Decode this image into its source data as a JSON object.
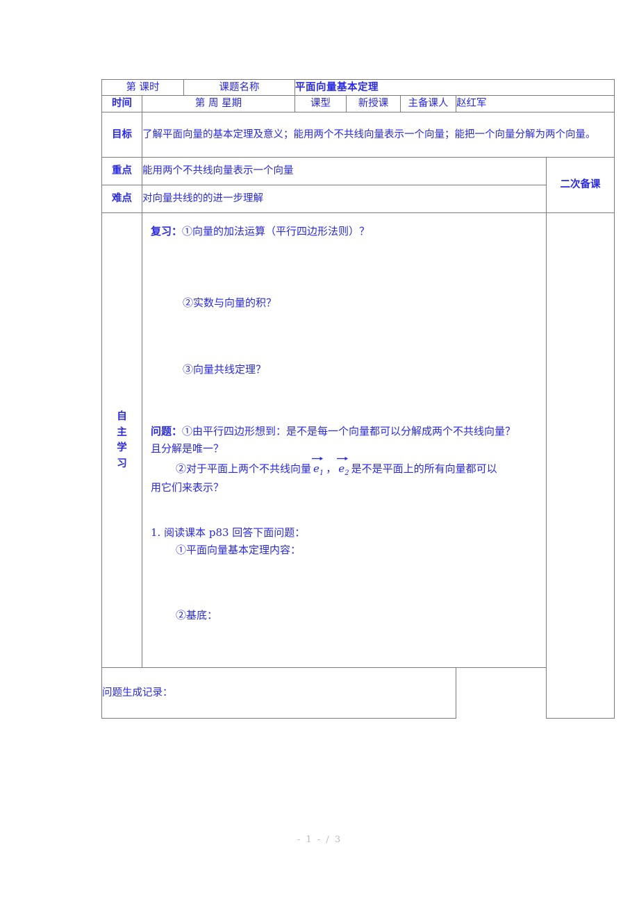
{
  "document": {
    "title": "平面向量基本定理",
    "text_color": "#2929e4",
    "title_color": "#111111",
    "border_color": "#7a7a7a"
  },
  "header": {
    "period_label": "第      课时",
    "topic_label": "课题名称",
    "topic_value": "平面向量基本定理",
    "time_label": "时间",
    "week_day_label": "第    周    星期",
    "class_type_label": "课型",
    "class_type_value": "新授课",
    "preparer_label": "主备课人",
    "preparer_value": "赵红军"
  },
  "goal": {
    "label": "目标",
    "text": "了解平面向量的基本定理及意义；能用两个不共线向量表示一个向量；能把一个向量分解为两个向量。"
  },
  "key_point": {
    "label": "重点",
    "text": "能用两个不共线向量表示一个向量"
  },
  "difficulty": {
    "label": "难点",
    "text": "对向量共线的的进一步理解"
  },
  "second_prep": {
    "label": "二次备课"
  },
  "side_label": {
    "chars": [
      "自",
      "主",
      "学",
      "习"
    ]
  },
  "body": {
    "review": {
      "lead": "复习：",
      "item1": "①向量的加法运算（平行四边形法则）？",
      "item2": "②实数与向量的积？",
      "item3": "③向量共线定理？"
    },
    "questions": {
      "lead": "问题：",
      "q1_line1": "①由平行四边形想到：是不是每一个向量都可以分解成两个不共线向量？",
      "q1_line2": "且分解是唯一？",
      "q2_prefix": "②对于平面上两个不共线向量",
      "q2_vec1": "e",
      "q2_vec1_sub": "1",
      "q2_separator": "，",
      "q2_vec2": "e",
      "q2_vec2_sub": "2",
      "q2_suffix": "是不是平面上的所有向量都可以",
      "q2_line2": "用它们来表示？"
    },
    "reading": {
      "lead": "1. 阅读课本 p83 回答下面问题：",
      "item1": "①平面向量基本定理内容：",
      "item2": "②基底："
    },
    "record": {
      "label": "问题生成记录："
    }
  },
  "footer": {
    "text": "- 1 - / 3"
  }
}
